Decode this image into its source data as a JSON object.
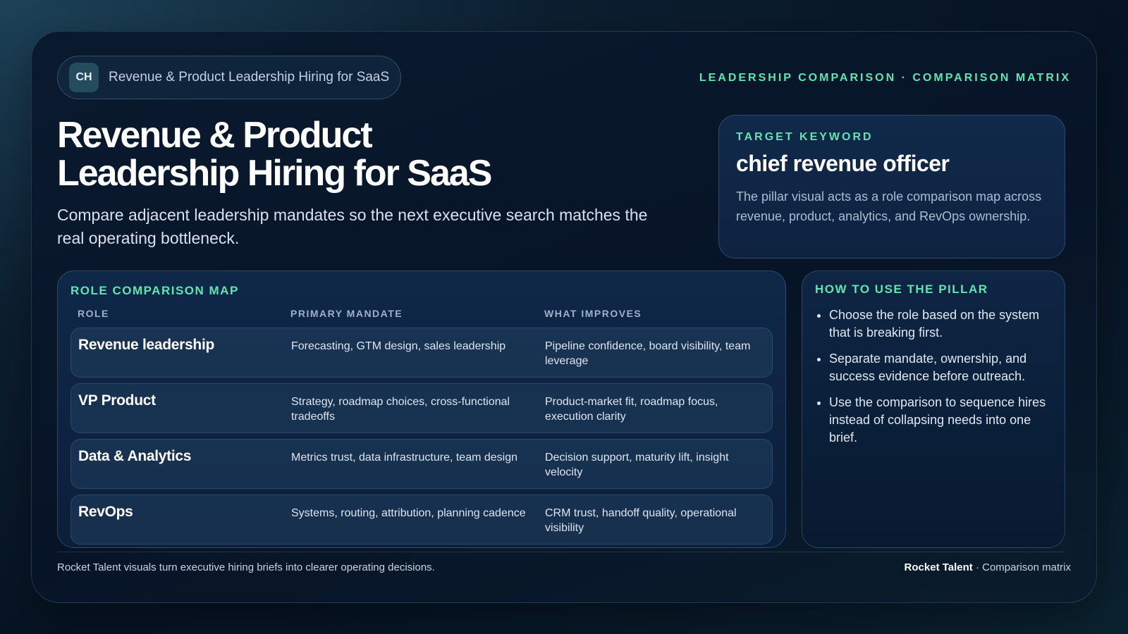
{
  "header": {
    "badge": "CH",
    "pill_text": "Revenue & Product Leadership Hiring for SaaS",
    "eyebrow": "LEADERSHIP COMPARISON · COMPARISON MATRIX"
  },
  "hero": {
    "title_line1": "Revenue & Product",
    "title_line2": "Leadership Hiring for SaaS",
    "subtitle": "Compare adjacent leadership mandates so the next executive search matches the real operating bottleneck."
  },
  "keyword": {
    "label": "TARGET KEYWORD",
    "value": "chief revenue officer",
    "description": "The pillar visual acts as a role comparison map across revenue, product, analytics, and RevOps ownership."
  },
  "map": {
    "label": "ROLE COMPARISON MAP",
    "columns": [
      "ROLE",
      "PRIMARY MANDATE",
      "WHAT IMPROVES"
    ],
    "rows": [
      {
        "role": "Revenue leadership",
        "mandate": "Forecasting, GTM design, sales leadership",
        "improves": "Pipeline confidence, board visibility, team leverage"
      },
      {
        "role": "VP Product",
        "mandate": "Strategy, roadmap choices, cross-functional tradeoffs",
        "improves": "Product-market fit, roadmap focus, execution clarity"
      },
      {
        "role": "Data & Analytics",
        "mandate": "Metrics trust, data infrastructure, team design",
        "improves": "Decision support, maturity lift, insight velocity"
      },
      {
        "role": "RevOps",
        "mandate": "Systems, routing, attribution, planning cadence",
        "improves": "CRM trust, handoff quality, operational visibility"
      }
    ]
  },
  "how_to": {
    "label": "HOW TO USE THE PILLAR",
    "items": [
      "Choose the role based on the system that is breaking first.",
      "Separate mandate, ownership, and success evidence before outreach.",
      "Use the comparison to sequence hires instead of collapsing needs into one brief."
    ]
  },
  "footer": {
    "left": "Rocket Talent visuals turn executive hiring briefs into clearer operating decisions.",
    "brand": "Rocket Talent",
    "suffix": " · Comparison matrix"
  },
  "colors": {
    "accent": "#5ee6b0",
    "background": "#071427",
    "text": "#ffffff"
  }
}
